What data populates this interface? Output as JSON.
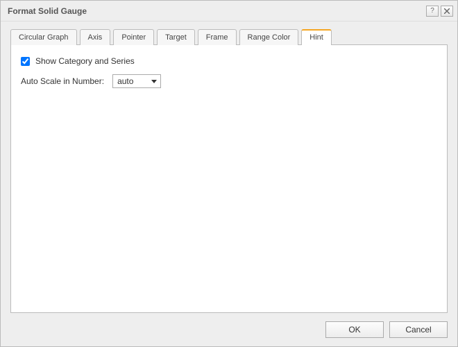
{
  "window": {
    "title": "Format Solid Gauge"
  },
  "tabs": [
    {
      "label": "Circular Graph"
    },
    {
      "label": "Axis"
    },
    {
      "label": "Pointer"
    },
    {
      "label": "Target"
    },
    {
      "label": "Frame"
    },
    {
      "label": "Range Color"
    },
    {
      "label": "Hint"
    }
  ],
  "hintPanel": {
    "showCategoryLabel": "Show Category and Series",
    "showCategoryChecked": true,
    "autoScaleLabel": "Auto Scale in Number:",
    "autoScaleValue": "auto"
  },
  "footer": {
    "ok": "OK",
    "cancel": "Cancel"
  }
}
